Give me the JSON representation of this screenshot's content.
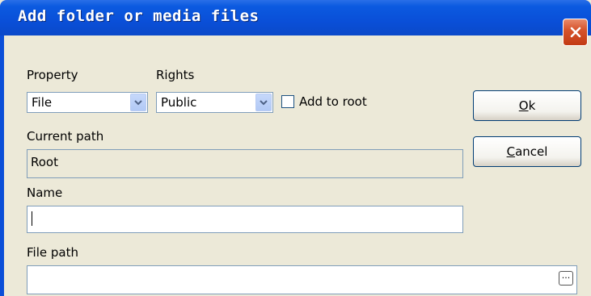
{
  "window": {
    "title": "Add folder or media files"
  },
  "form": {
    "property": {
      "label": "Property",
      "value": "File"
    },
    "rights": {
      "label": "Rights",
      "value": "Public"
    },
    "add_to_root": {
      "label": "Add to root",
      "checked": false
    },
    "current_path": {
      "label": "Current path",
      "value": "Root"
    },
    "name": {
      "label": "Name",
      "value": ""
    },
    "file_path": {
      "label": "File path",
      "value": "",
      "browse_label": "..."
    }
  },
  "buttons": {
    "ok": {
      "underlined": "O",
      "rest": "k"
    },
    "cancel": {
      "underlined": "C",
      "rest": "ancel"
    }
  },
  "icons": {
    "close": "close-icon",
    "dropdown": "chevron-down-icon"
  },
  "colors": {
    "titlebar": "#0b4fd8",
    "dialog_bg": "#ece9d8",
    "close_button": "#d6542d",
    "field_border": "#7f9db9"
  }
}
